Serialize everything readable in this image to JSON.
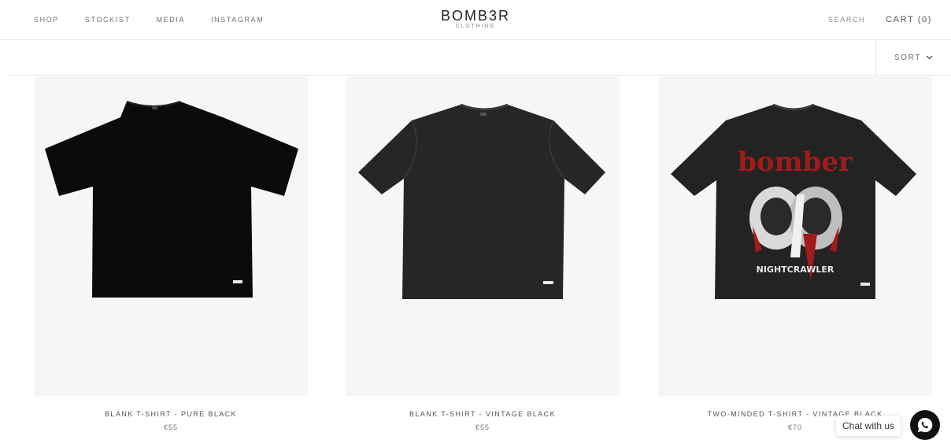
{
  "nav": {
    "items": [
      "SHOP",
      "STOCKIST",
      "MEDIA",
      "INSTAGRAM"
    ]
  },
  "logo": {
    "main": "BOMB3R",
    "sub": "CLOTHING"
  },
  "header": {
    "search_label": "SEARCH",
    "cart_label": "CART (0)"
  },
  "toolbar": {
    "sort_label": "SORT"
  },
  "products": [
    {
      "title": "BLANK T-SHIRT - PURE BLACK",
      "price": "€55",
      "shirt_color": "#0b0b0b",
      "print": "none"
    },
    {
      "title": "BLANK T-SHIRT - VINTAGE BLACK",
      "price": "€55",
      "shirt_color": "#262626",
      "print": "none"
    },
    {
      "title": "TWO-MINDED T-SHIRT - VINTAGE BLACK",
      "price": "€70",
      "shirt_color": "#232323",
      "print": "bomber nightcrawler graphic",
      "graphic_text": "bomber",
      "graphic_subtext": "NIGHTCRAWLER"
    }
  ],
  "chat": {
    "label": "Chat with us",
    "icon": "whatsapp-icon"
  },
  "colors": {
    "border": "#e6e6e6",
    "image_bg": "#f6f6f6",
    "accent_red": "#a11b1b"
  }
}
